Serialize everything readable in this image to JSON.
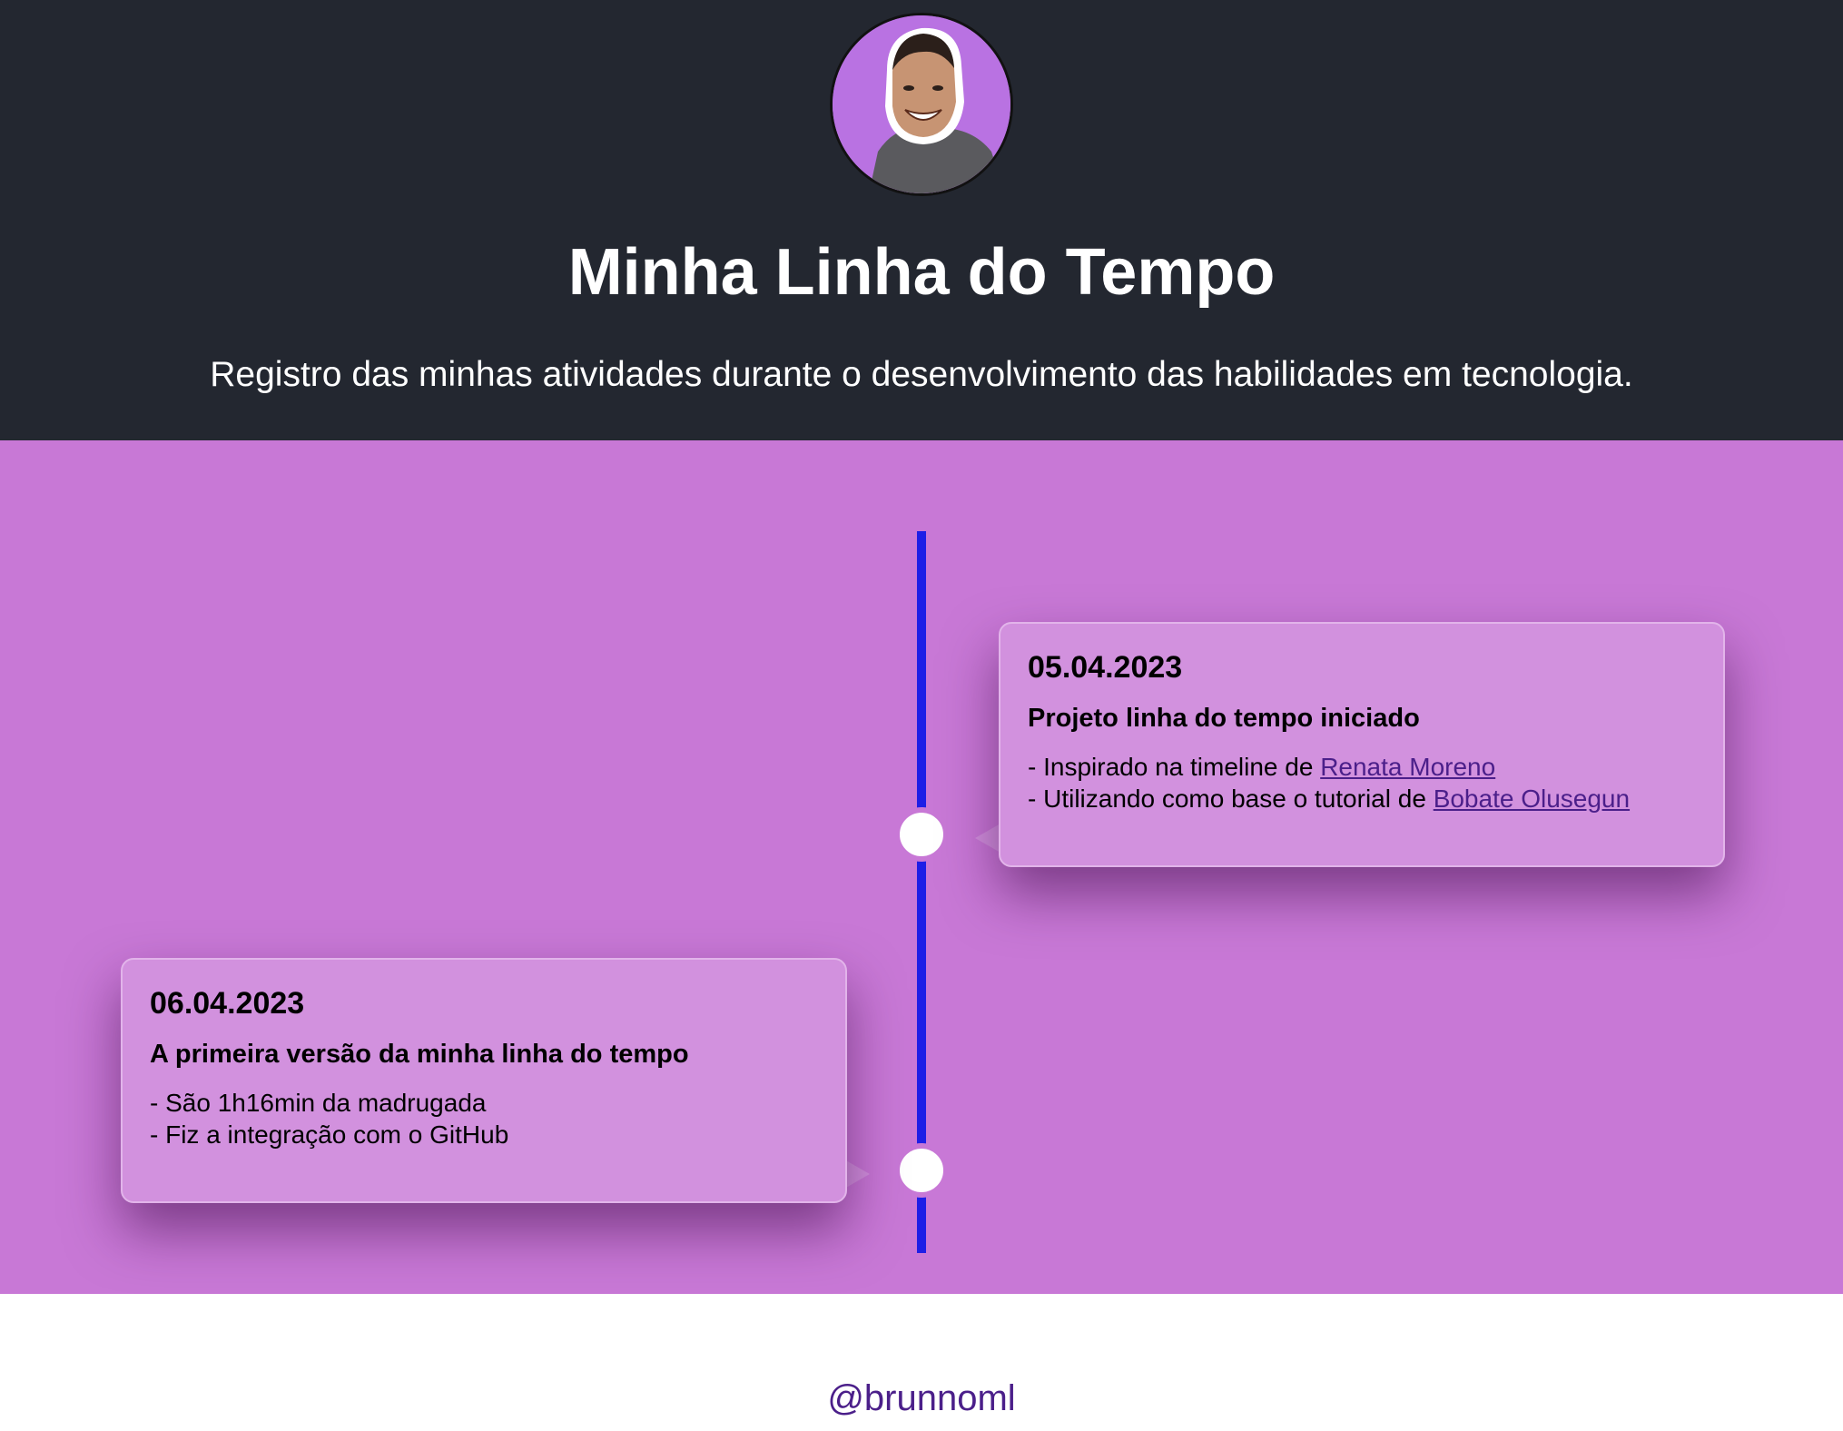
{
  "header": {
    "title": "Minha Linha do Tempo",
    "subtitle": "Registro das minhas atividades durante o desenvolvimento das habilidades em tecnologia."
  },
  "timeline": {
    "entries": [
      {
        "date": "05.04.2023",
        "title": "Projeto linha do tempo iniciado",
        "line1_prefix": "- Inspirado na timeline de ",
        "line1_link": "Renata Moreno",
        "line2_prefix": "- Utilizando como base o tutorial de ",
        "line2_link": "Bobate Olusegun"
      },
      {
        "date": "06.04.2023",
        "title": "A primeira versão da minha linha do tempo",
        "line1": "- São 1h16min da madrugada",
        "line2": "- Fiz a integração com o GitHub"
      }
    ]
  },
  "footer": {
    "handle": "@brunnoml"
  },
  "colors": {
    "header_bg": "#232730",
    "timeline_bg": "#c878d6",
    "card_bg": "#d291de",
    "line": "#1e1ee6",
    "link": "#4b1f8a"
  }
}
